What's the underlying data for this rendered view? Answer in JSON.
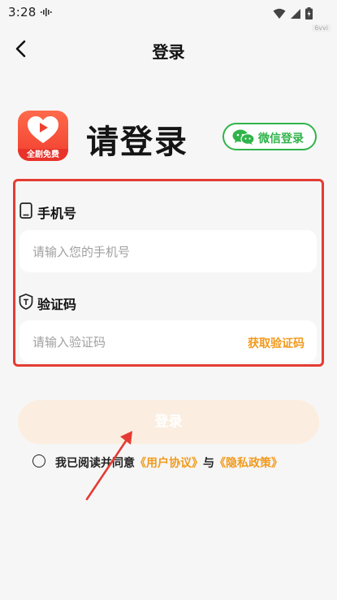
{
  "status_bar": {
    "time": "3:28"
  },
  "watermark": "6vvi",
  "header": {
    "title": "登录"
  },
  "brand": {
    "badge": "全剧免费",
    "heading": "请登录"
  },
  "wechat": {
    "label": "微信登录",
    "brand_color": "#2fb44a"
  },
  "phone": {
    "label": "手机号",
    "placeholder": "请输入您的手机号"
  },
  "code": {
    "label": "验证码",
    "placeholder": "请输入验证码",
    "get_code_label": "获取验证码"
  },
  "login_button": {
    "label": "登录"
  },
  "agreement": {
    "prefix": "我已阅读并同意",
    "user_agreement": "《用户协议》",
    "conjunction": "与",
    "privacy_policy": "《隐私政策》"
  },
  "colors": {
    "accent": "#f19a1d",
    "highlight": "#e43c33",
    "button_bg": "#fbeee0"
  }
}
